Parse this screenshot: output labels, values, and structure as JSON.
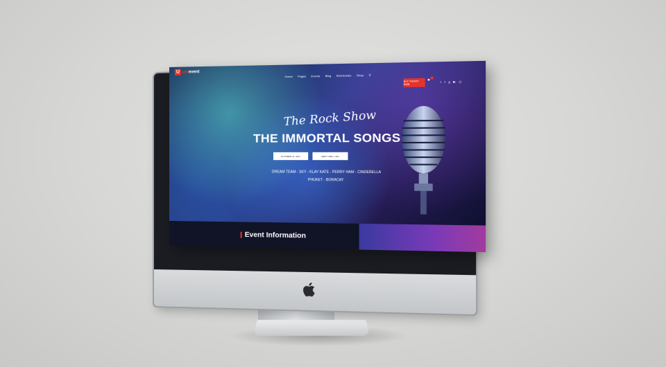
{
  "site": {
    "logo_mark": "U",
    "logo_prefix": "uni",
    "logo_suffix": "event",
    "menu": [
      "Home",
      "Pages",
      "Events",
      "Blog",
      "Shortcodes",
      "Shop"
    ],
    "cta_label": "BUY TICKET NOW",
    "icons": [
      "search-icon",
      "cart-icon",
      "twitter-icon",
      "facebook-icon",
      "google-plus-icon",
      "youtube-icon",
      "instagram-icon"
    ]
  },
  "hero": {
    "script_title": "The Rock Show",
    "title": "THE IMMORTAL SONGS",
    "date_tag": "OCTOBER 31, 2017",
    "place_tag": "NEW YORK, USA",
    "lineup_line1": "DREAM TEAM - SKY - KLAY KATE - PERRY HAM - CINDERELLA",
    "lineup_line2": "PHUKET - BORACAY"
  },
  "section": {
    "title": "Event Information"
  },
  "colors": {
    "accent": "#e63329",
    "background": "#d8d9d7"
  }
}
